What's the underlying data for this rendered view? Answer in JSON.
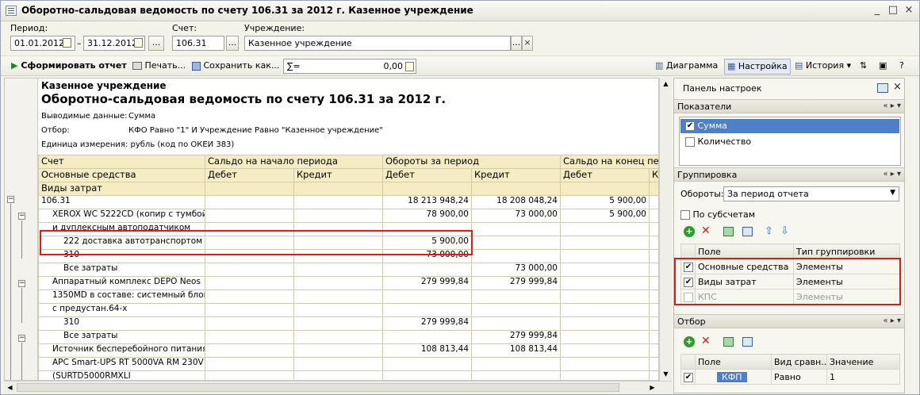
{
  "window": {
    "title": "Оборотно-сальдовая ведомость по счету 106.31 за 2012 г. Казенное учреждение",
    "controls": [
      "_",
      "□",
      "×"
    ]
  },
  "filters": {
    "period_label": "Период:",
    "period_from": "01.01.2012",
    "period_dash": "–",
    "period_to": "31.12.2012",
    "ellipsis": "...",
    "account_label": "Счет:",
    "account_value": "106.31",
    "org_label": "Учреждение:",
    "org_value": "Казенное учреждение"
  },
  "toolbar": {
    "generate": "Сформировать отчет",
    "print": "Печать...",
    "save": "Сохранить как...",
    "sum_sign": "∑=",
    "sum_value": "0,00",
    "chart": "Диаграмма",
    "settings": "Настройка",
    "history": "История"
  },
  "report": {
    "org": "Казенное учреждение",
    "title": "Оборотно-сальдовая ведомость по счету 106.31 за 2012 г.",
    "output_label": "Выводимые данные:",
    "output_value": "Сумма",
    "filter_label": "Отбор:",
    "filter_value": "КФО Равно \"1\" И Учреждение Равно \"Казенное учреждение\"",
    "unit": "Единица измерения: рубль (код по ОКЕИ 383)",
    "headers": {
      "account": "Счет",
      "fixed_assets": "Основные средства",
      "cost_types": "Виды затрат",
      "opening": "Сальдо на начало периода",
      "turnover": "Обороты за период",
      "closing": "Сальдо на конец пери",
      "debit": "Дебет",
      "credit": "Кредит",
      "debit2": "Дебет",
      "credit2": "Кредит",
      "debit3": "Дебет",
      "credit3": "К"
    },
    "rows": [
      {
        "name": "106.31",
        "c": [
          "",
          "",
          "18 213 948,24",
          "18 208 048,24",
          "5 900,00",
          ""
        ]
      },
      {
        "name": "XEROX WC 5222CD (копир с тумбой",
        "c": [
          "",
          "",
          "78 900,00",
          "73 000,00",
          "5 900,00",
          ""
        ]
      },
      {
        "name": "и дуплексным автоподатчиком",
        "c": [
          "",
          "",
          "",
          "",
          "",
          ""
        ]
      },
      {
        "name": "222 доставка автотранспортом",
        "c": [
          "",
          "",
          "5 900,00",
          "",
          "",
          ""
        ]
      },
      {
        "name": "310",
        "c": [
          "",
          "",
          "73 000,00",
          "",
          "",
          ""
        ]
      },
      {
        "name": "Все затраты",
        "c": [
          "",
          "",
          "",
          "73 000,00",
          "",
          ""
        ]
      },
      {
        "name": "Аппаратный комплекс DEPO Neos",
        "c": [
          "",
          "",
          "279 999,84",
          "279 999,84",
          "",
          ""
        ]
      },
      {
        "name": "1350MD в составе: системный блок",
        "c": [
          "",
          "",
          "",
          "",
          "",
          ""
        ]
      },
      {
        "name": "с предустан.64-х",
        "c": [
          "",
          "",
          "",
          "",
          "",
          ""
        ]
      },
      {
        "name": "310",
        "c": [
          "",
          "",
          "279 999,84",
          "",
          "",
          ""
        ]
      },
      {
        "name": "Все затраты",
        "c": [
          "",
          "",
          "",
          "279 999,84",
          "",
          ""
        ]
      },
      {
        "name": "Источник бесперебойного питания",
        "c": [
          "",
          "",
          "108 813,44",
          "108 813,44",
          "",
          ""
        ]
      },
      {
        "name": "APC Smart-UPS RT 5000VA RM 230V",
        "c": [
          "",
          "",
          "",
          "",
          "",
          ""
        ]
      },
      {
        "name": "(SURTD5000RMXLI",
        "c": [
          "",
          "",
          "",
          "",
          "",
          ""
        ]
      },
      {
        "name": "310",
        "c": [
          "",
          "",
          "108 813,44",
          "",
          "",
          ""
        ]
      },
      {
        "name": "Все затраты",
        "c": [
          "",
          "",
          "",
          "108 813,44",
          "",
          ""
        ]
      }
    ]
  },
  "panel": {
    "title": "Панель настроек",
    "indicators_title": "Показатели",
    "indicators": [
      {
        "label": "Сумма",
        "checked": true
      },
      {
        "label": "Количество",
        "checked": false
      }
    ],
    "grouping_title": "Группировка",
    "turnover_label": "Обороты:",
    "turnover_value": "За период отчета",
    "subaccounts_label": "По субсчетам",
    "grid_headers": {
      "field": "Поле",
      "type": "Тип группировки"
    },
    "groups": [
      {
        "field": "Основные средства",
        "type": "Элементы",
        "checked": true
      },
      {
        "field": "Виды затрат",
        "type": "Элементы",
        "checked": true
      },
      {
        "field": "КПС",
        "type": "Элементы",
        "checked": false
      }
    ],
    "filter_title": "Отбор",
    "filter_headers": {
      "field": "Поле",
      "comparison": "Вид сравн...",
      "value": "Значение"
    },
    "filter_rows": [
      {
        "field": "КФП",
        "comparison": "Равно",
        "value": "1"
      }
    ],
    "section_ctrl": "« ▸ ▾"
  },
  "colors": {
    "highlight": "#e01818",
    "select": "#4d80c8",
    "header": "#f5ecc3"
  }
}
